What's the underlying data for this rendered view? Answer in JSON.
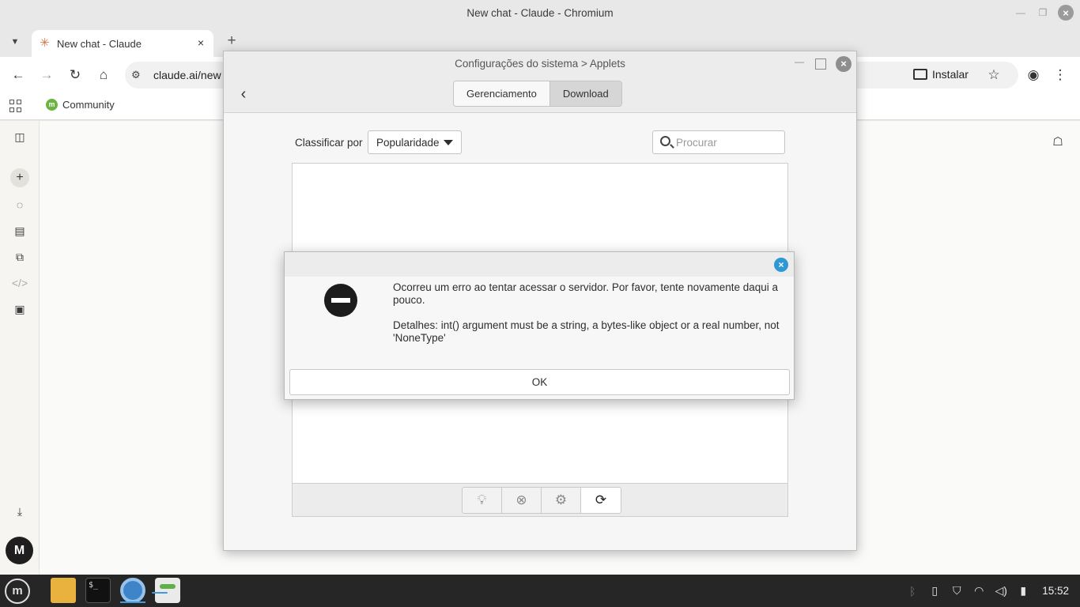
{
  "browser": {
    "window_title": "New chat - Claude - Chromium",
    "tab_title": "New chat - Claude",
    "url": "claude.ai/new",
    "install_label": "Instalar",
    "bookmark_community": "Community"
  },
  "claude": {
    "avatar_initial": "M"
  },
  "settings": {
    "title": "Configurações do sistema > Applets",
    "tabs": [
      "Gerenciamento",
      "Download"
    ],
    "active_tab": "Download",
    "sort_label": "Classificar por",
    "sort_value": "Popularidade",
    "search_placeholder": "Procurar"
  },
  "dialog": {
    "message": "Ocorreu um erro ao tentar acessar o servidor. Por favor, tente novamente daqui a pouco.",
    "details": "Detalhes: int() argument must be a string, a bytes-like object or a real number, not 'NoneType'",
    "ok_label": "OK"
  },
  "taskbar": {
    "clock": "15:52"
  },
  "colors": {
    "dialog_close": "#2d98d4",
    "taskbar_bg": "#262626",
    "mint_green": "#69b53f"
  }
}
